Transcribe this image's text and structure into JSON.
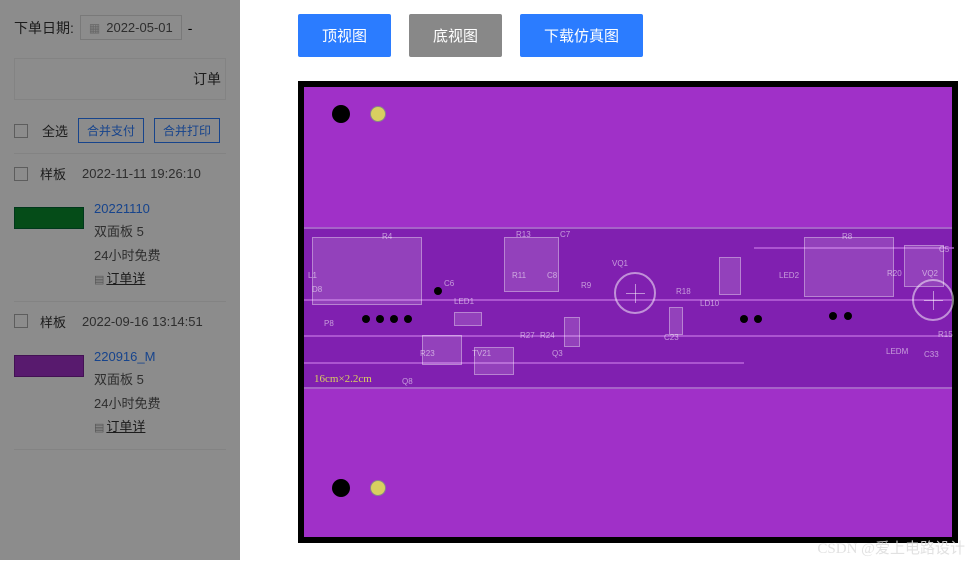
{
  "sidebar": {
    "date_label": "下单日期:",
    "date_value": "2022-05-01",
    "date_sep": "-",
    "order_header": "订单",
    "select_all": "全选",
    "merge_pay": "合并支付",
    "merge_print": "合并打印",
    "items": [
      {
        "type": "样板",
        "time": "2022-11-11 19:26:10",
        "link": "20221110",
        "line1": "双面板  5",
        "line2": "24小时免费",
        "detail": "订单详"
      },
      {
        "type": "样板",
        "time": "2022-09-16 13:14:51",
        "link": "220916_M",
        "line1": "双面板  5",
        "line2": "24小时免费",
        "detail": "订单详"
      }
    ]
  },
  "buttons": {
    "top_view": "顶视图",
    "bottom_view": "底视图",
    "download": "下载仿真图"
  },
  "pcb": {
    "dimension": "16cm×2.2cm",
    "refs": {
      "r4": "R4",
      "r8": "R8",
      "r13": "R13",
      "c7": "C7",
      "r11": "R11",
      "c8": "C8",
      "led1": "LED1",
      "led2": "LED2",
      "r20": "R20",
      "vq2": "VQ2",
      "c5": "C5",
      "c33": "C33",
      "r15": "R15",
      "d8": "D8",
      "p8": "P8",
      "r23": "R23",
      "tv21": "TV21",
      "q3": "Q3",
      "c23": "C23",
      "r27": "R27",
      "r24": "R24",
      "r18": "R18",
      "ld10": "LD10",
      "r9": "R9",
      "ledm": "LEDM",
      "q8": "Q8",
      "l1": "L1",
      "c6": "C6",
      "vq1": "VQ1"
    }
  },
  "watermark": "CSDN @爱上电路设计"
}
